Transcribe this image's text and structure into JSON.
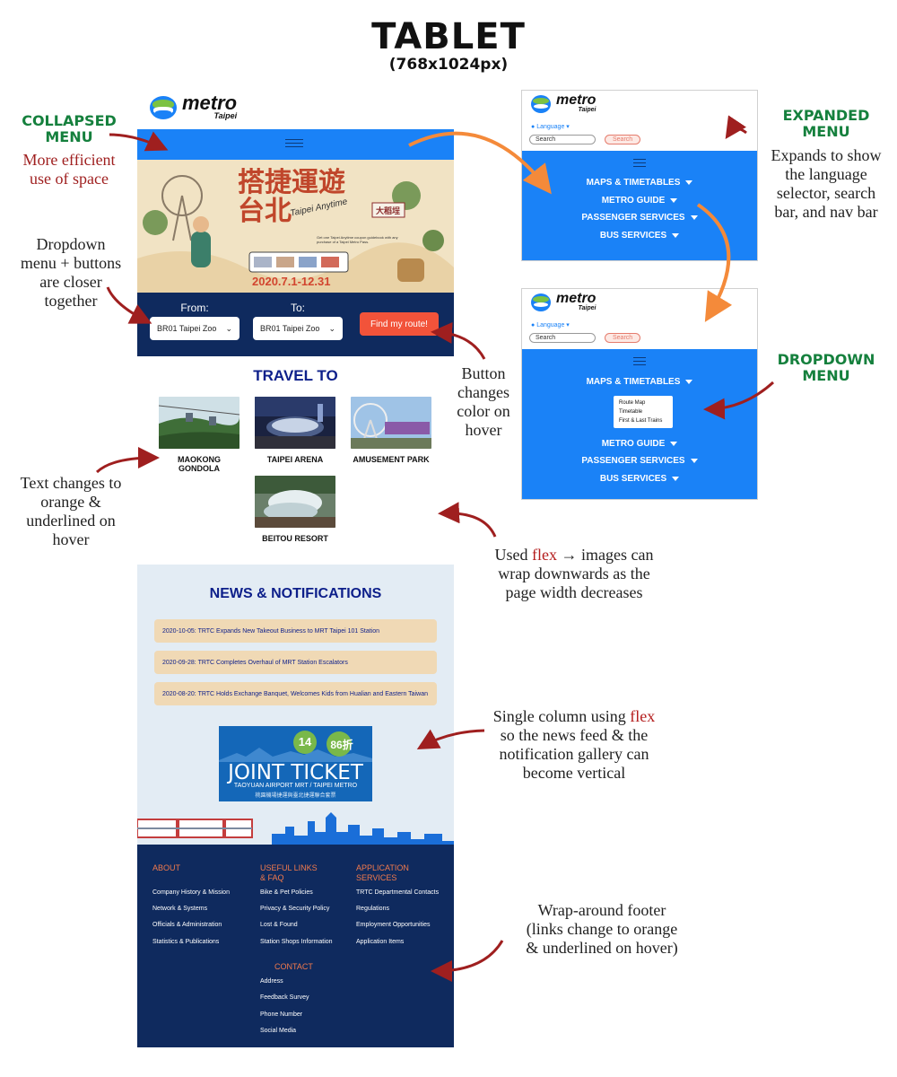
{
  "header": {
    "title": "TABLET",
    "subtitle": "(768x1024px)"
  },
  "annotations": {
    "collapsed_title": "COLLAPSED\nMENU",
    "collapsed_sub": "More efficient\nuse of space",
    "dropdown_buttons": "Dropdown\nmenu + buttons\nare closer\ntogether",
    "text_hover": "Text changes to\norange &\nunderlined on\nhover",
    "button_hover": "Button\nchanges\ncolor on\nhover",
    "expanded_title": "EXPANDED\nMENU",
    "expanded_desc": "Expands to show\nthe language\nselector, search\nbar, and nav bar",
    "dropdown_title": "DROPDOWN\nMENU",
    "flex_images_pre": "Used ",
    "flex_images_kw": "flex",
    "flex_images_post": " → images can\nwrap downwards as the\npage width decreases",
    "single_col_pre": "Single column using ",
    "single_col_kw": "flex",
    "single_col_post": "\nso the news feed & the\nnotification gallery can\nbecome vertical",
    "footer_note": "Wrap-around footer\n(links change to orange\n& underlined on hover)"
  },
  "logo": {
    "word": "metro",
    "sub": "Taipei"
  },
  "hero": {
    "title": "搭捷運遊台北",
    "script": "Taipei Anytime",
    "badge": "大稻埕",
    "promo": "Get one Taipei Anytime coupon guidebook with any purchase of a Taipei Metro Pass.",
    "dates": "2020.7.1-12.31"
  },
  "route": {
    "from_label": "From:",
    "to_label": "To:",
    "from_value": "BR01 Taipei Zoo",
    "to_value": "BR01 Taipei Zoo",
    "find_button": "Find my route!"
  },
  "travel": {
    "title": "TRAVEL TO",
    "destinations": [
      "MAOKONG GONDOLA",
      "TAIPEI ARENA",
      "AMUSEMENT PARK",
      "BEITOU RESORT"
    ]
  },
  "news": {
    "title": "NEWS & NOTIFICATIONS",
    "items": [
      "2020-10-05: TRTC Expands New Takeout Business to MRT Taipei 101 Station",
      "2020-09-28: TRTC Completes Overhaul of MRT Station Escalators",
      "2020-08-20: TRTC Holds Exchange Banquet, Welcomes Kids from Hualian and Eastern Taiwan"
    ],
    "ticket": {
      "line1": "JOINT TICKET",
      "line2": "TAOYUAN AIRPORT MRT / TAIPEI METRO",
      "line3": "桃園機場捷運與臺北捷運聯合套票",
      "badge1": "14",
      "badge2": "86折"
    }
  },
  "footer": {
    "about": {
      "heading": "ABOUT",
      "links": [
        "Company History & Mission",
        "Network & Systems",
        "Officials & Administration",
        "Statistics & Publications"
      ]
    },
    "useful": {
      "heading": "USEFUL LINKS\n& FAQ",
      "links": [
        "Bike & Pet Policies",
        "Privacy & Security Policy",
        "Lost & Found",
        "Station Shops Information"
      ]
    },
    "apps": {
      "heading": "APPLICATION\nSERVICES",
      "links": [
        "TRTC Departmental Contacts",
        "Regulations",
        "Employment Opportunities",
        "Application Items"
      ]
    },
    "contact": {
      "heading": "CONTACT",
      "links": [
        "Address",
        "Feedback Survey",
        "Phone Number",
        "Social Media"
      ]
    }
  },
  "menu": {
    "language": "Language",
    "search_placeholder": "Search",
    "search_button": "Search",
    "nav": [
      "MAPS & TIMETABLES",
      "METRO GUIDE",
      "PASSENGER SERVICES",
      "BUS SERVICES"
    ],
    "dropdown": [
      "Route Map",
      "Timetable",
      "First & Last Trains"
    ]
  },
  "colors": {
    "blue": "#1a82f7",
    "navy": "#0f2a5e",
    "orange_btn": "#f2533a",
    "green_label": "#15803d",
    "red_note": "#9f1f1f"
  }
}
